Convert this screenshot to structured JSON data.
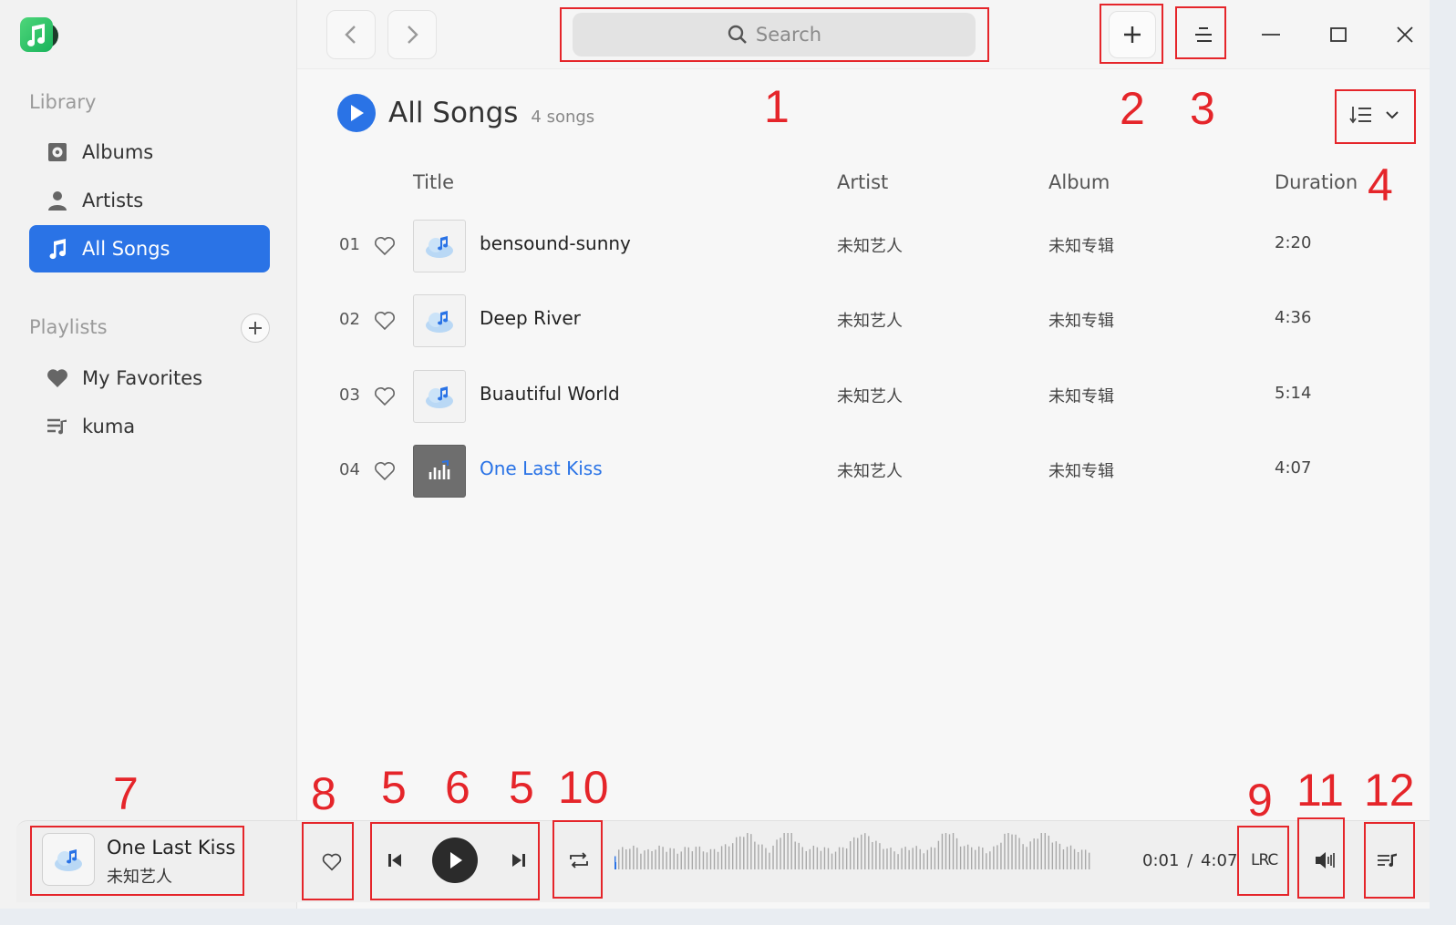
{
  "sidebar": {
    "library_label": "Library",
    "items": [
      {
        "label": "Albums",
        "icon": "album-icon"
      },
      {
        "label": "Artists",
        "icon": "artist-icon"
      },
      {
        "label": "All Songs",
        "icon": "music-note-icon",
        "active": true
      }
    ],
    "playlists_label": "Playlists",
    "playlists": [
      {
        "label": "My Favorites",
        "icon": "heart-icon"
      },
      {
        "label": "kuma",
        "icon": "playlist-icon"
      }
    ]
  },
  "topbar": {
    "search_placeholder": "Search"
  },
  "main": {
    "title": "All Songs",
    "count": "4 songs",
    "columns": {
      "title": "Title",
      "artist": "Artist",
      "album": "Album",
      "duration": "Duration"
    },
    "songs": [
      {
        "index": "01",
        "title": "bensound-sunny",
        "artist": "未知艺人",
        "album": "未知专辑",
        "duration": "2:20",
        "playing": false
      },
      {
        "index": "02",
        "title": "Deep River",
        "artist": "未知艺人",
        "album": "未知专辑",
        "duration": "4:36",
        "playing": false
      },
      {
        "index": "03",
        "title": "Buautiful World",
        "artist": "未知艺人",
        "album": "未知专辑",
        "duration": "5:14",
        "playing": false
      },
      {
        "index": "04",
        "title": "One Last Kiss",
        "artist": "未知艺人",
        "album": "未知专辑",
        "duration": "4:07",
        "playing": true
      }
    ]
  },
  "player": {
    "now_title": "One Last Kiss",
    "now_artist": "未知艺人",
    "current_time": "0:01",
    "separator": "/",
    "total_time": "4:07",
    "progress": 0.004,
    "lrc_label": "LRC"
  },
  "annotations": [
    "1",
    "2",
    "3",
    "4",
    "5",
    "6",
    "5",
    "10",
    "7",
    "8",
    "9",
    "11",
    "12"
  ],
  "colors": {
    "accent": "#2a73e6",
    "annotation": "#e5252a"
  }
}
